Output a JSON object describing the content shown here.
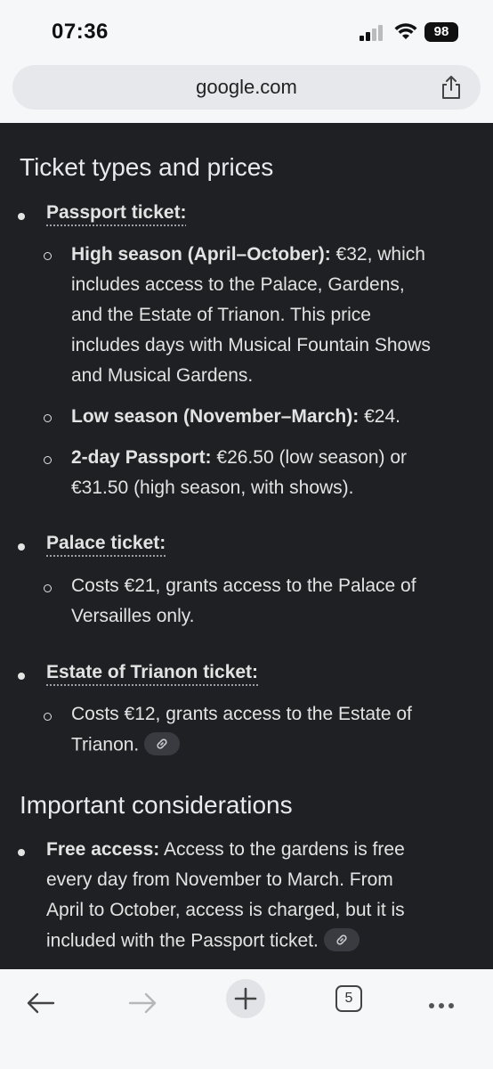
{
  "status": {
    "time": "07:36",
    "battery": "98"
  },
  "browser": {
    "url": "google.com",
    "tab_count": "5"
  },
  "content": {
    "heading1": "Ticket types and prices",
    "passport": {
      "title": "Passport ticket:",
      "high_label": "High season (April–October):",
      "high_text": [
        " €32, which",
        "includes access to the Palace, Gardens,",
        "and the Estate of Trianon. This price",
        "includes days with Musical Fountain Shows",
        "and Musical Gardens."
      ],
      "low_label": "Low season (November–March):",
      "low_text": " €24.",
      "twoday_label": "2-day Passport:",
      "twoday_text": [
        " €26.50 (low season) or",
        "€31.50 (high season, with shows)."
      ]
    },
    "palace": {
      "title": "Palace ticket:",
      "text": [
        "Costs €21, grants access to the Palace of",
        "Versailles only."
      ]
    },
    "trianon": {
      "title": "Estate of Trianon ticket:",
      "text": [
        "Costs €12, grants access to the Estate of",
        "Trianon."
      ]
    },
    "heading2": "Important considerations",
    "free": {
      "label": "Free access:",
      "text": [
        " Access to the gardens is free",
        "every day from November to March. From",
        "April to October, access is charged, but it is",
        "included with the Passport ticket."
      ]
    }
  }
}
